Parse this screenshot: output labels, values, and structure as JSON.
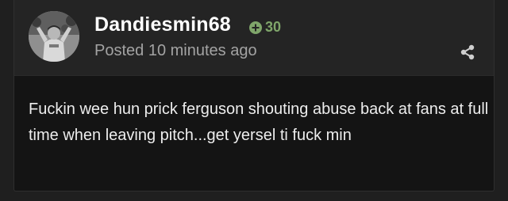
{
  "post": {
    "author": {
      "username": "Dandiesmin68",
      "reputation": "30",
      "avatar_icon": "avatar-photo"
    },
    "posted_time": "Posted 10 minutes ago",
    "share_icon": "share-icon",
    "content": "Fuckin wee hun prick ferguson shouting abuse back at fans at full time when leaving pitch...get yersel ti fuck min"
  },
  "colors": {
    "page_background": "#1f1f1f",
    "header_background": "#242424",
    "body_background": "#141414",
    "reputation_green": "#7fa56a",
    "muted_text": "#a3a3a3"
  }
}
